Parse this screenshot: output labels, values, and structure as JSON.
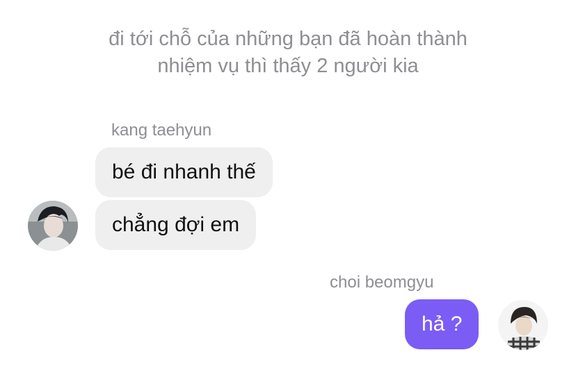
{
  "narration": {
    "line1": "đi tới chỗ của những bạn đã hoàn thành",
    "line2": "nhiệm vụ thì thấy 2 người kia"
  },
  "incoming": {
    "sender": "kang taehyun",
    "messages": [
      "bé đi nhanh thế",
      "chẳng đợi em"
    ],
    "avatar_icon": "profile-photo-dark-hair"
  },
  "outgoing": {
    "sender": "choi beomgyu",
    "messages": [
      "hả ?"
    ],
    "avatar_icon": "profile-photo-plaid-shirt"
  },
  "colors": {
    "outgoing_bubble": "#7b5cf5",
    "incoming_bubble": "#efefef",
    "meta_text": "#8e8e93"
  }
}
